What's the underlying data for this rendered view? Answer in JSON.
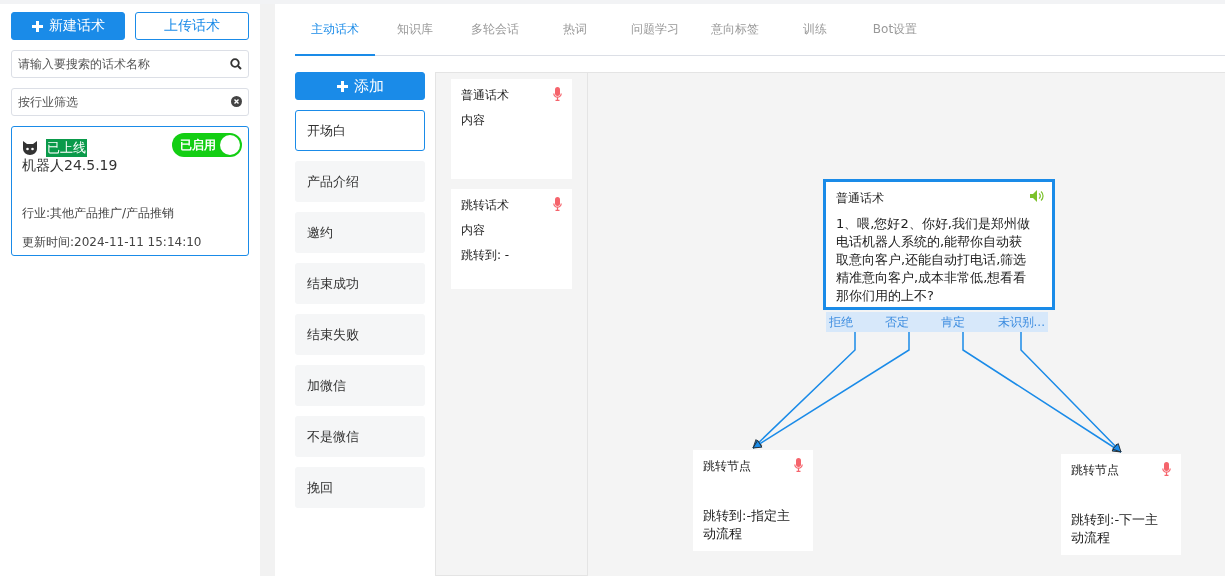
{
  "sidebar": {
    "new_button": "新建话术",
    "upload_button": "上传话术",
    "search": {
      "placeholder": "请输入要搜索的话术名称"
    },
    "industry_filter": {
      "placeholder": "按行业筛选"
    },
    "bots": [
      {
        "status": "已上线",
        "name": "机器人24.5.19",
        "toggle_label": "已启用",
        "on": true,
        "selected": true,
        "industry": "行业:其他产品推广/产品推销",
        "updated": "更新时间:2024-11-11 15:14:10"
      }
    ]
  },
  "tabs": [
    {
      "label": "主动话术",
      "selected": true
    },
    {
      "label": "知识库",
      "selected": false
    },
    {
      "label": "多轮会话",
      "selected": false
    },
    {
      "label": "热词",
      "selected": false
    },
    {
      "label": "问题学习",
      "selected": false
    },
    {
      "label": "意向标签",
      "selected": false
    },
    {
      "label": "训练",
      "selected": false
    },
    {
      "label": "Bot设置",
      "selected": false
    }
  ],
  "add_button": "添加",
  "flows": [
    {
      "label": "开场白",
      "selected": true
    },
    {
      "label": "产品介绍",
      "selected": false
    },
    {
      "label": "邀约",
      "selected": false
    },
    {
      "label": "结束成功",
      "selected": false
    },
    {
      "label": "结束失败",
      "selected": false
    },
    {
      "label": "加微信",
      "selected": false
    },
    {
      "label": "不是微信",
      "selected": false
    },
    {
      "label": "挽回",
      "selected": false
    }
  ],
  "templates": [
    {
      "title": "普通话术",
      "lines": [
        "内容"
      ]
    },
    {
      "title": "跳转话术",
      "lines": [
        "内容",
        "跳转到: -"
      ]
    }
  ],
  "canvas": {
    "main_node": {
      "title": "普通话术",
      "text": "1、喂,您好2、你好,我们是郑州做电话机器人系统的,能帮你自动获取意向客户,还能自动打电话,筛选精准意向客户,成本非常低,想看看那你们用的上不?",
      "branches": [
        "拒绝",
        "否定",
        "肯定",
        "未识别..."
      ]
    },
    "jump_nodes": [
      {
        "title": "跳转节点",
        "target": "跳转到:-指定主动流程"
      },
      {
        "title": "跳转节点",
        "target": "跳转到:-下一主动流程"
      }
    ]
  }
}
